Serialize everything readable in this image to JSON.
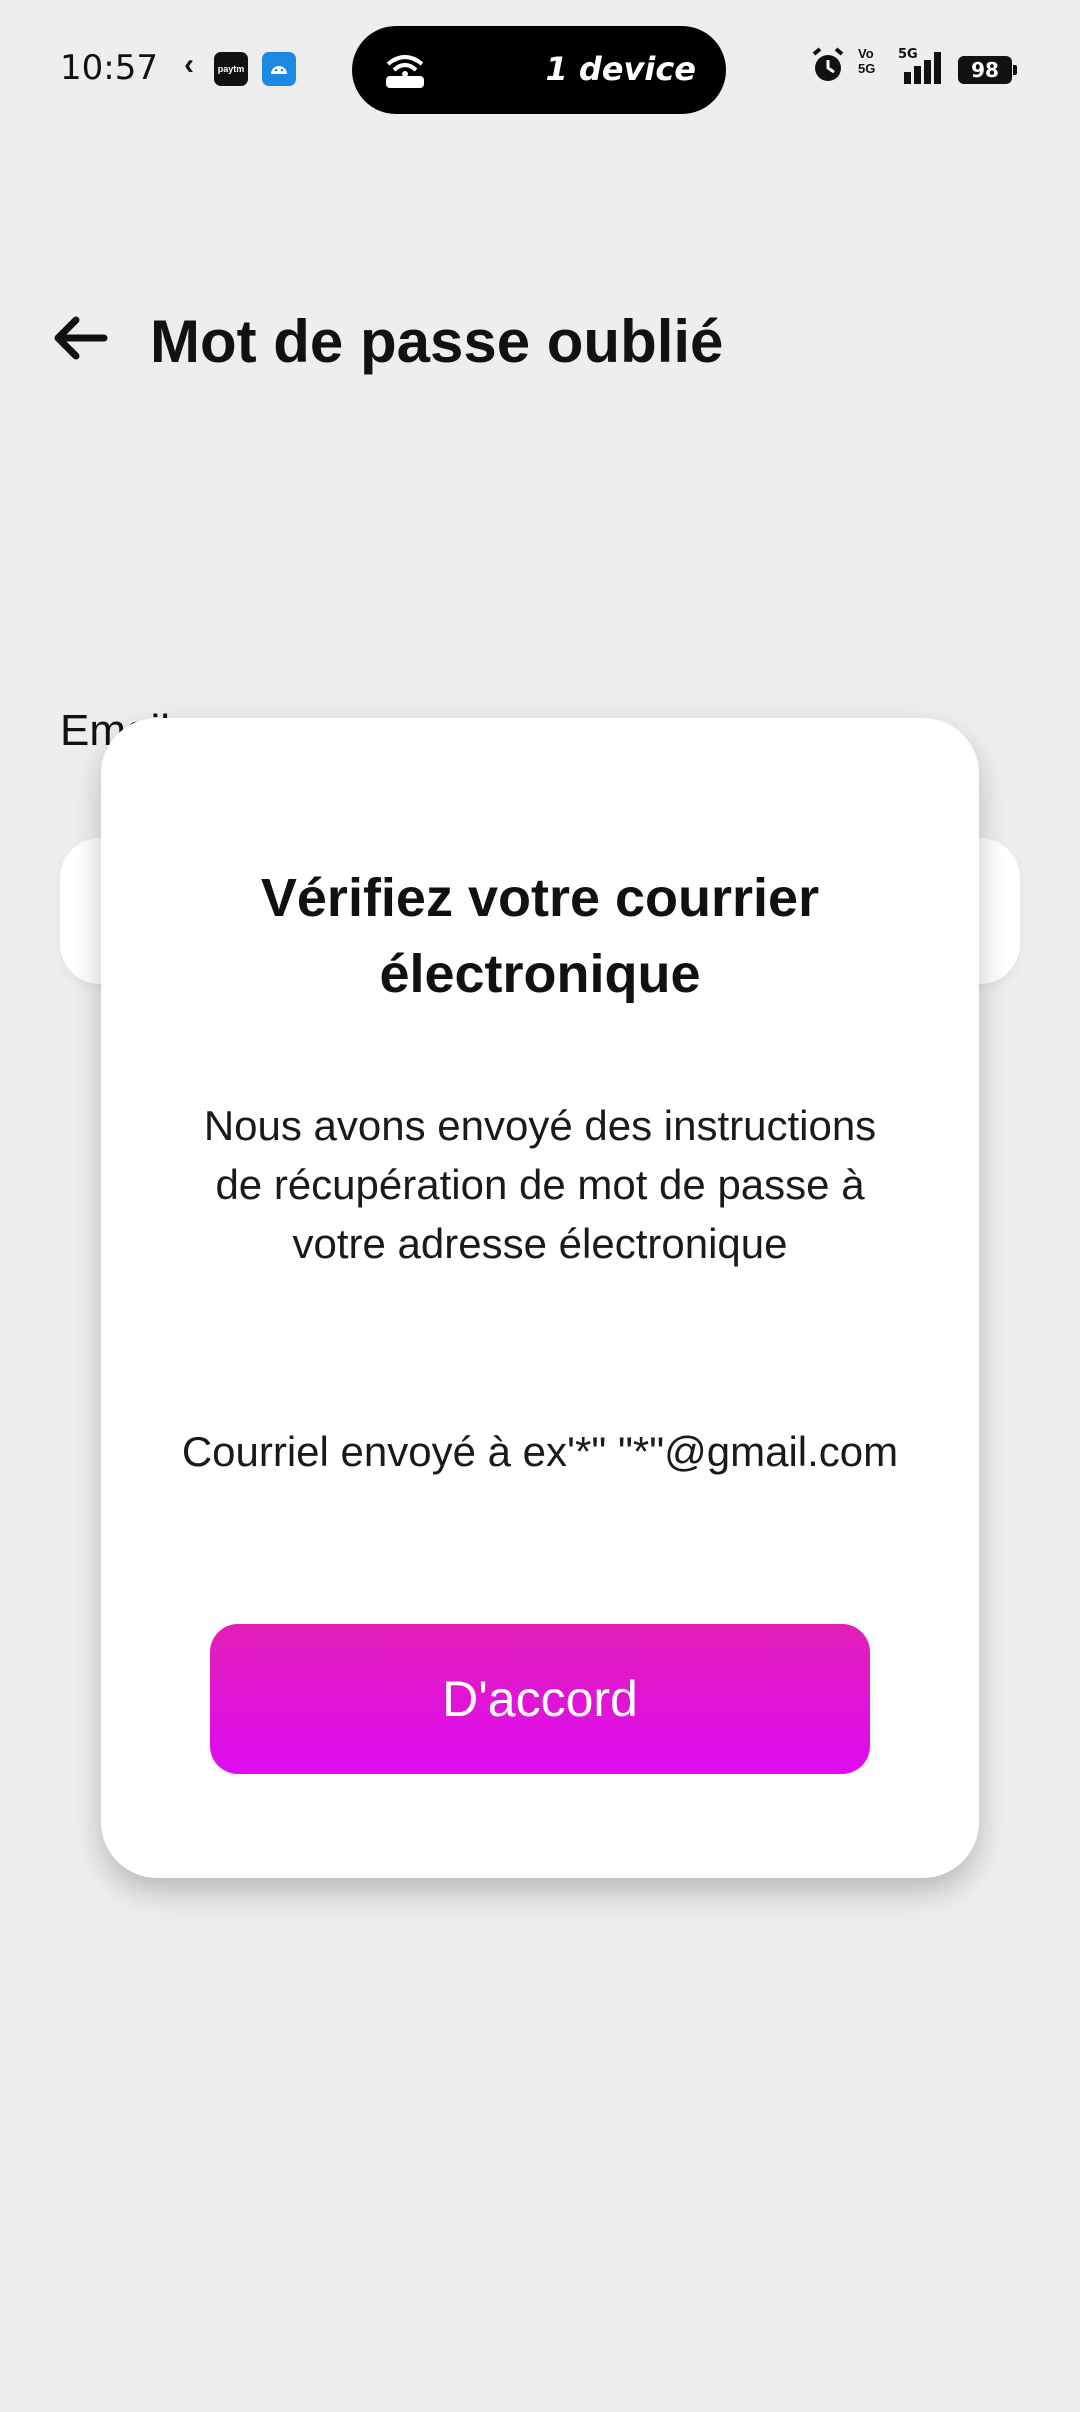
{
  "status_bar": {
    "time": "10:57",
    "hotspot_text": "1 device",
    "battery": "98",
    "volte": "Vo\n5G",
    "network": "5G",
    "icons": [
      "k-icon",
      "paytm-icon",
      "android-icon",
      "hotspot-icon",
      "alarm-icon",
      "volte-icon",
      "signal-icon",
      "battery-icon"
    ]
  },
  "header": {
    "title": "Mot de passe oublié",
    "back_icon": "arrow-left-icon"
  },
  "form": {
    "email_label": "Email",
    "email_value": ""
  },
  "dialog": {
    "title": "Vérifiez votre courrier électronique",
    "message": "Nous avons envoyé des instructions de récupération de mot de passe à votre adresse électronique",
    "sent_to": "Courriel envoyé à ex'*\" \"*\"@gmail.com",
    "ok_label": "D'accord"
  },
  "colors": {
    "background": "#eeeeee",
    "dialog": "#ffffff",
    "button_gradient_start": "#e21fb8",
    "button_gradient_end": "#de0bf2"
  }
}
